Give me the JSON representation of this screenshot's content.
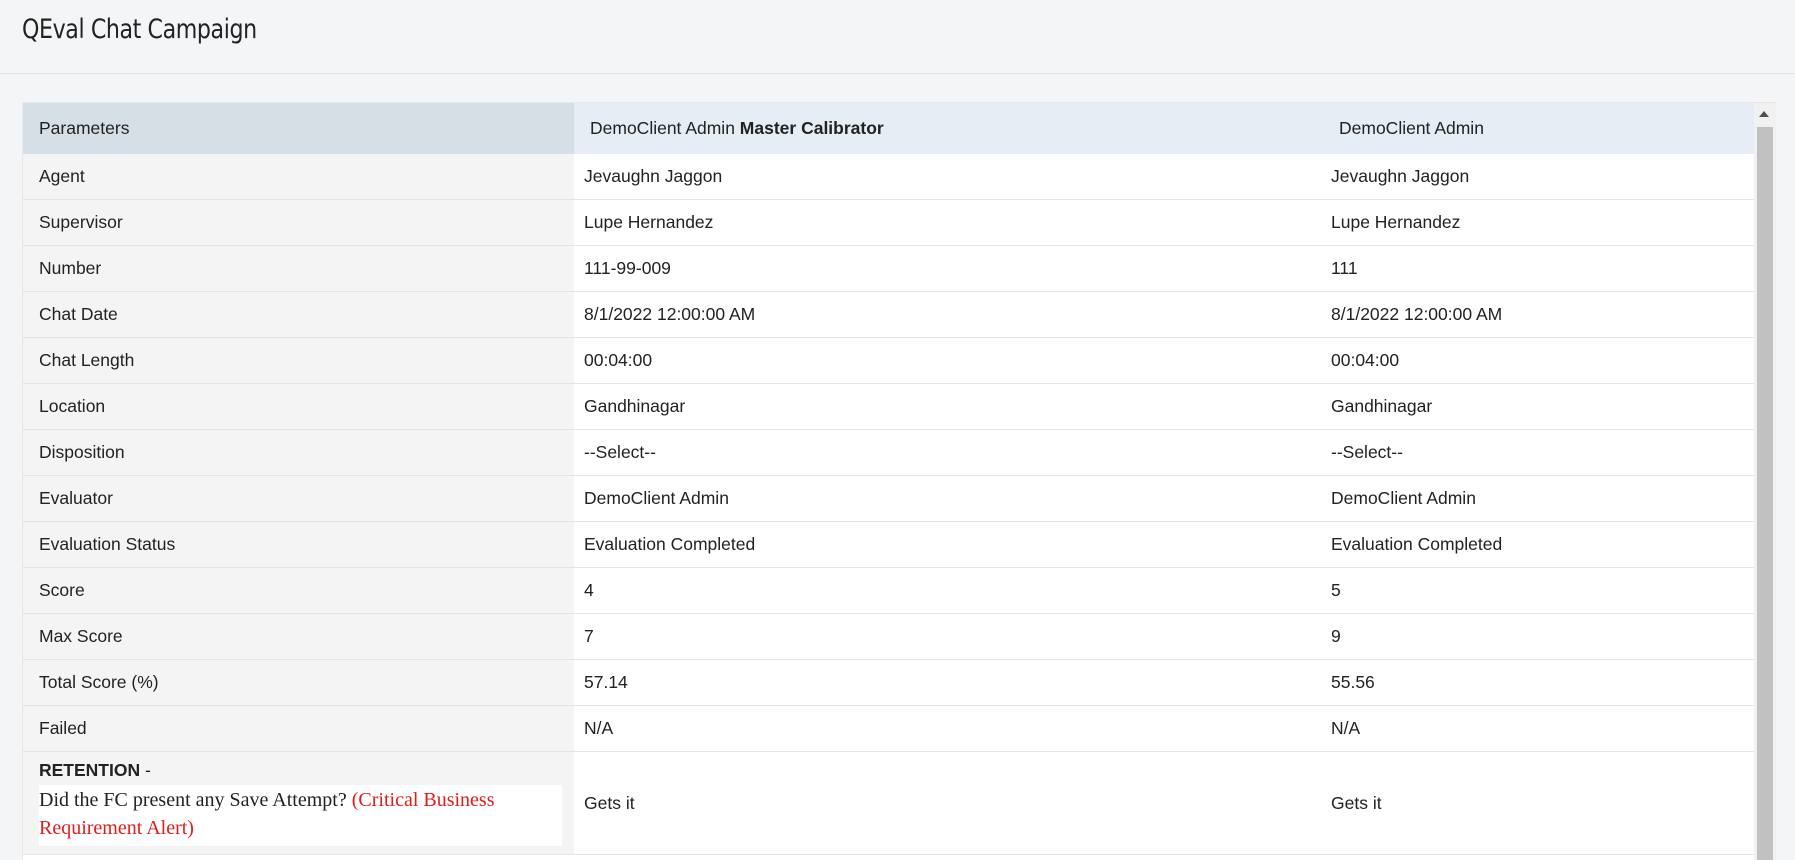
{
  "page": {
    "title": "QEval Chat Campaign"
  },
  "table": {
    "headers": {
      "parameters": "Parameters",
      "col1_name": "DemoClient Admin",
      "col1_role": "Master Calibrator",
      "col2_name": "DemoClient Admin"
    },
    "rows": [
      {
        "label": "Agent",
        "v1": "Jevaughn Jaggon",
        "v2": "Jevaughn Jaggon"
      },
      {
        "label": "Supervisor",
        "v1": "Lupe Hernandez",
        "v2": "Lupe Hernandez"
      },
      {
        "label": "Number",
        "v1": "111-99-009",
        "v2": "111"
      },
      {
        "label": "Chat Date",
        "v1": "8/1/2022 12:00:00 AM",
        "v2": "8/1/2022 12:00:00 AM"
      },
      {
        "label": "Chat Length",
        "v1": "00:04:00",
        "v2": "00:04:00"
      },
      {
        "label": "Location",
        "v1": "Gandhinagar",
        "v2": "Gandhinagar"
      },
      {
        "label": "Disposition",
        "v1": "--Select--",
        "v2": "--Select--"
      },
      {
        "label": "Evaluator",
        "v1": "DemoClient Admin",
        "v2": "DemoClient Admin"
      },
      {
        "label": "Evaluation Status",
        "v1": "Evaluation Completed",
        "v2": "Evaluation Completed"
      },
      {
        "label": "Score",
        "v1": "4",
        "v2": "5"
      },
      {
        "label": "Max Score",
        "v1": "7",
        "v2": "9"
      },
      {
        "label": "Total Score (%)",
        "v1": "57.14",
        "v2": "55.56"
      },
      {
        "label": "Failed",
        "v1": "N/A",
        "v2": "N/A"
      }
    ],
    "question": {
      "section": "RETENTION",
      "separator": " -",
      "text": "Did the FC present any Save Attempt? ",
      "alert": "(Critical Business Requirement Alert)",
      "v1": "Gets it",
      "v2": "Gets it"
    }
  },
  "colors": {
    "alert": "#e41b1b",
    "header_bg": "#e6edf5",
    "param_header_bg": "#d6dee6",
    "param_bg": "#f4f4f4"
  },
  "icons": {
    "scroll_up": "triangle-up-icon"
  }
}
